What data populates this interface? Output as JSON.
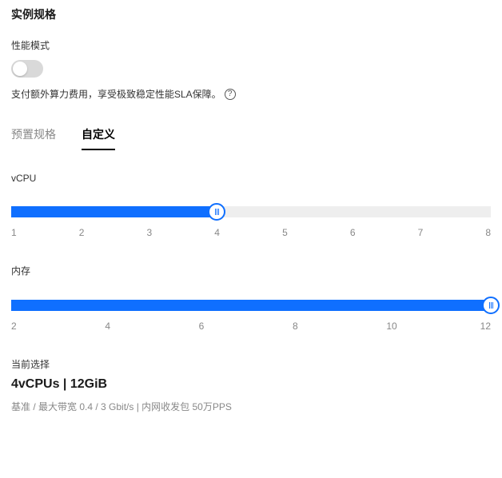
{
  "section_title": "实例规格",
  "performance_mode": {
    "label": "性能模式",
    "enabled": false,
    "description": "支付额外算力费用，享受极致稳定性能SLA保障。"
  },
  "tabs": {
    "preset": "预置规格",
    "custom": "自定义",
    "active": "custom"
  },
  "vcpu": {
    "label": "vCPU",
    "min": 1,
    "max": 8,
    "value": 4,
    "ticks": [
      "1",
      "2",
      "3",
      "4",
      "5",
      "6",
      "7",
      "8"
    ]
  },
  "memory": {
    "label": "内存",
    "min": 2,
    "max": 12,
    "value": 12,
    "ticks": [
      "2",
      "4",
      "6",
      "8",
      "10",
      "12"
    ]
  },
  "current": {
    "label": "当前选择",
    "value": "4vCPUs | 12GiB",
    "specs": "基准 / 最大带宽  0.4 / 3 Gbit/s   |   内网收发包  50万PPS"
  },
  "chart_data": {
    "type": "table",
    "vcpu_count": 4,
    "memory_gib": 12,
    "bandwidth_baseline_gbit_s": 0.4,
    "bandwidth_max_gbit_s": 3,
    "pps": "50万"
  }
}
